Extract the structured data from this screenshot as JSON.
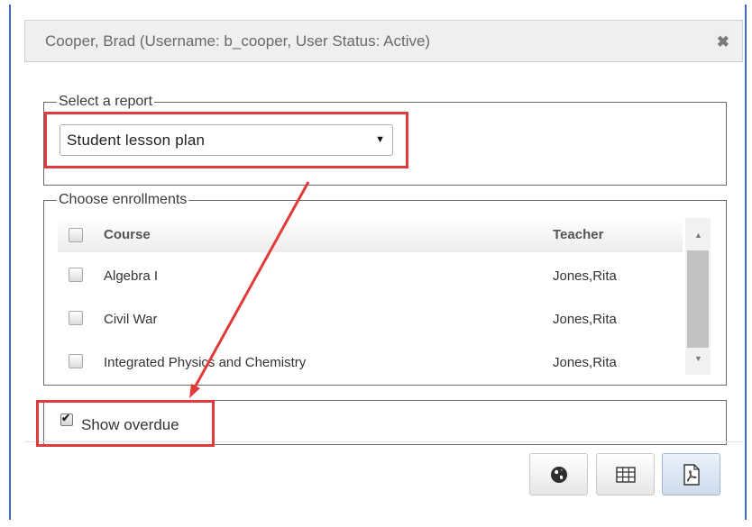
{
  "dialog": {
    "title": "Cooper, Brad (Username: b_cooper, User Status: Active)",
    "close_glyph": "✖"
  },
  "report_section": {
    "legend": "Select a report",
    "selected_report": "Student lesson plan",
    "arrow_glyph": "▼"
  },
  "enrollments_section": {
    "legend": "Choose enrollments",
    "columns": [
      "Course",
      "Teacher"
    ],
    "rows": [
      {
        "course": "Algebra I",
        "teacher": "Jones,Rita",
        "checked": false
      },
      {
        "course": "Civil War",
        "teacher": "Jones,Rita",
        "checked": false
      },
      {
        "course": "Integrated Physics and Chemistry",
        "teacher": "Jones,Rita",
        "checked": false
      }
    ],
    "scroll_up_glyph": "▲",
    "scroll_down_glyph": "▼"
  },
  "options": {
    "show_overdue_label": "Show overdue",
    "show_overdue_checked": true,
    "check_glyph": "✔"
  },
  "footer_buttons": [
    {
      "icon": "globe-icon"
    },
    {
      "icon": "table-icon"
    },
    {
      "icon": "pdf-icon",
      "active": true
    }
  ],
  "colors": {
    "annotation_red": "#e03a3a",
    "frame_blue": "#3d6fb5"
  }
}
